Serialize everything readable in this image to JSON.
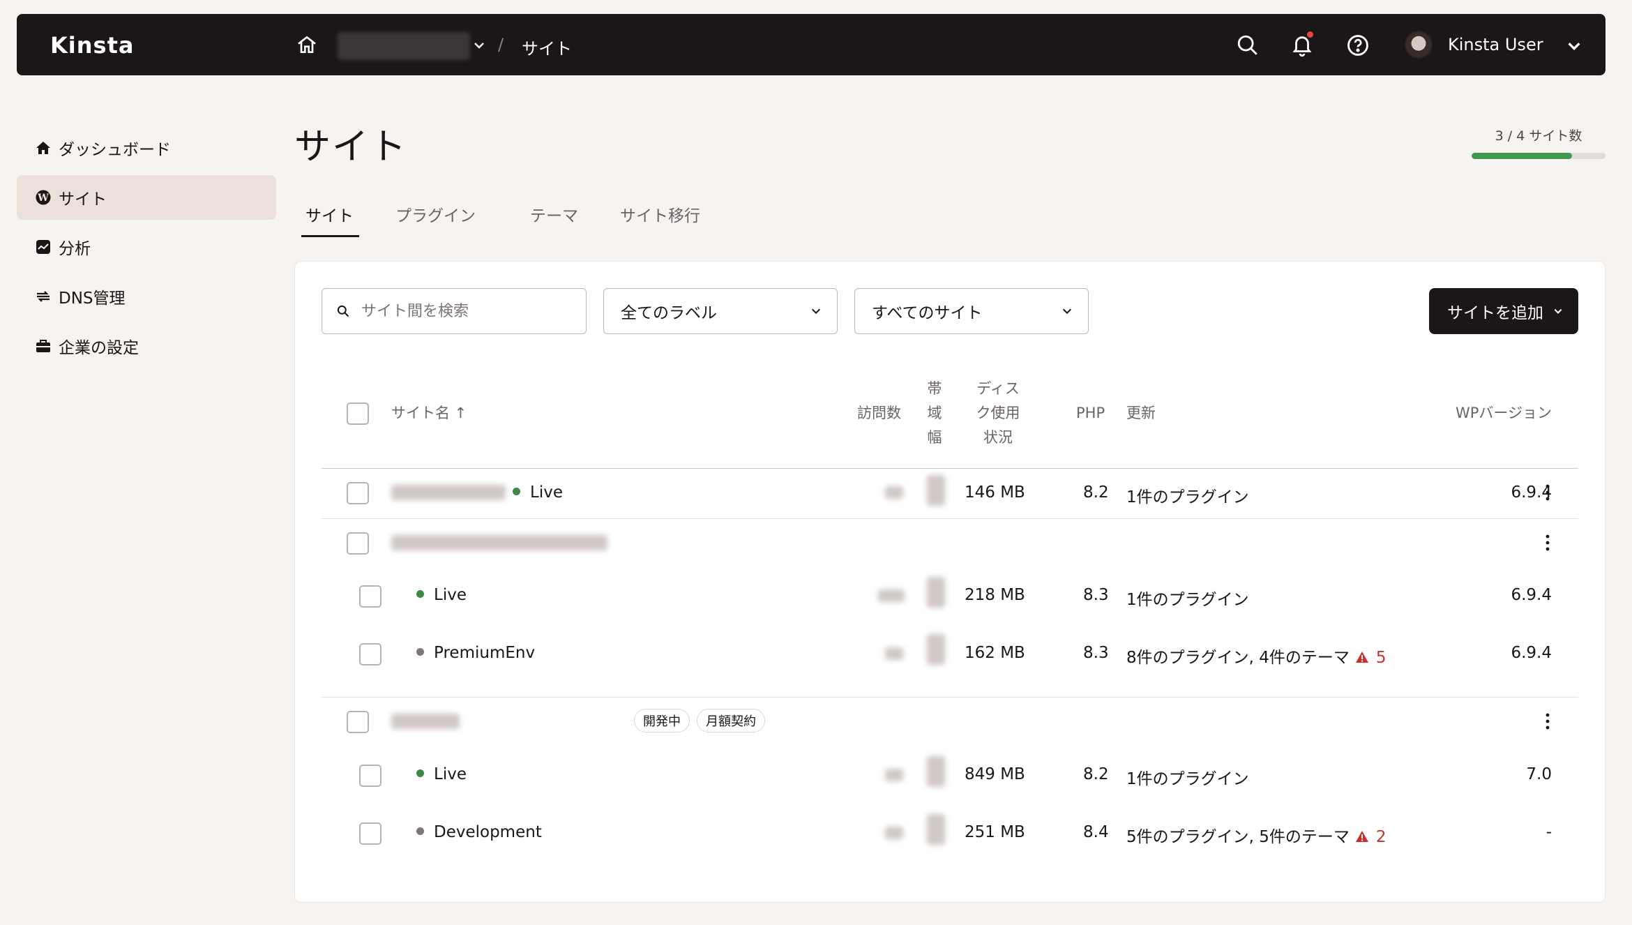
{
  "header": {
    "logo": "Kinsta",
    "breadcrumb_current": "サイト",
    "breadcrumb_sep": "/",
    "user_name": "Kinsta User"
  },
  "sidebar": {
    "items": [
      {
        "label": "ダッシュボード",
        "icon": "home-icon",
        "active": false
      },
      {
        "label": "サイト",
        "icon": "wordpress-icon",
        "active": true
      },
      {
        "label": "分析",
        "icon": "analytics-icon",
        "active": false
      },
      {
        "label": "DNS管理",
        "icon": "dns-icon",
        "active": false
      },
      {
        "label": "企業の設定",
        "icon": "briefcase-icon",
        "active": false
      }
    ]
  },
  "page": {
    "title": "サイト",
    "quota_text": "3 / 4 サイト数",
    "quota_used": 3,
    "quota_total": 4
  },
  "tabs": [
    "サイト",
    "プラグイン",
    "テーマ",
    "サイト移行"
  ],
  "toolbar": {
    "search_placeholder": "サイト間を検索",
    "label_filter": "全てのラベル",
    "site_filter": "すべてのサイト",
    "add_button": "サイトを追加"
  },
  "table": {
    "columns": {
      "name": "サイト名 ↑",
      "visits": "訪問数",
      "bandwidth": [
        "帯",
        "域",
        "幅"
      ],
      "disk": [
        "ディス",
        "ク使用",
        "状況"
      ],
      "php": "PHP",
      "updates": "更新",
      "wp": "WPバージョン"
    },
    "rows": [
      {
        "env": "Live",
        "status": "green",
        "disk": "146 MB",
        "php": "8.2",
        "updates": "1件のプラグイン",
        "wp": "6.9.4"
      },
      {
        "env": "Live",
        "status": "green",
        "disk": "218 MB",
        "php": "8.3",
        "updates": "1件のプラグイン",
        "wp": "6.9.4"
      },
      {
        "env": "PremiumEnv",
        "status": "gray",
        "disk": "162 MB",
        "php": "8.3",
        "updates": "8件のプラグイン, 4件のテーマ",
        "warning": "5",
        "wp": "6.9.4"
      },
      {
        "env": "Live",
        "status": "green",
        "disk": "849 MB",
        "php": "8.2",
        "updates": "1件のプラグイン",
        "wp": "7.0"
      },
      {
        "env": "Development",
        "status": "gray",
        "disk": "251 MB",
        "php": "8.4",
        "updates": "5件のプラグイン, 5件のテーマ",
        "warning": "2",
        "wp": "-"
      }
    ],
    "tags": [
      "開発中",
      "月額契約"
    ]
  },
  "colors": {
    "accent_dark": "#1b1718",
    "live_green": "#3c8a45",
    "warning_red": "#c8302b",
    "quota_green": "#3f9a4b"
  }
}
